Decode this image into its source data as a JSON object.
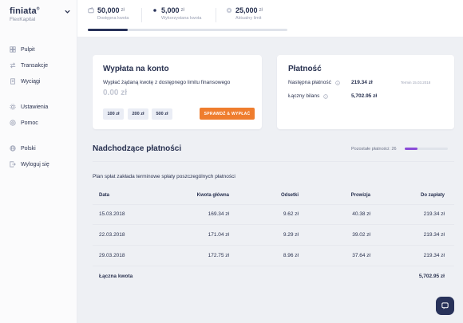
{
  "brand": {
    "name": "finiata",
    "trademark": "®",
    "product": "FlexKapital"
  },
  "sidebar": {
    "items": [
      {
        "label": "Pulpit",
        "icon": "dashboard-icon"
      },
      {
        "label": "Transakcje",
        "icon": "transactions-icon"
      },
      {
        "label": "Wyciągi",
        "icon": "statements-icon"
      },
      {
        "label": "Ustawienia",
        "icon": "gear-icon"
      },
      {
        "label": "Pomoc",
        "icon": "help-icon"
      },
      {
        "label": "Polski",
        "icon": "globe-icon"
      },
      {
        "label": "Wyloguj się",
        "icon": "logout-icon"
      }
    ]
  },
  "stats": [
    {
      "value": "50,000",
      "unit": "zł",
      "label": "Dostępna kwota",
      "icon": "wallet-icon"
    },
    {
      "value": "5,000",
      "unit": "zł",
      "label": "Wykorzystana kwota",
      "icon": "dot-icon"
    },
    {
      "value": "25,000",
      "unit": "zł",
      "label": "Aktualny limit",
      "icon": "limit-icon"
    }
  ],
  "usage_progress": 0.2,
  "withdraw": {
    "title": "Wypłata na konto",
    "description": "Wypłać żądaną kwotę z dostępnego limitu finansowego",
    "amount_placeholder": "0.00 zł",
    "chips": [
      "100 zł",
      "200 zł",
      "500 zł"
    ],
    "button": "SPRAWDŹ & WYPŁAĆ"
  },
  "payment": {
    "title": "Płatność",
    "next_label": "Następna płatność",
    "next_value": "219.34 zł",
    "due": "Termin 15.03.2018",
    "balance_label": "Łączny bilans",
    "balance_value": "5,702.95 zł"
  },
  "upcoming": {
    "title": "Nadchodzące płatności",
    "remaining": "Pozostałe płatności: 26",
    "remaining_progress": 0.3,
    "plan": "Plan spłat zakłada terminowe spłaty poszczególnych płatności",
    "headers": [
      "Data",
      "Kwota główna",
      "Odsetki",
      "Prowizja",
      "Do zapłaty"
    ],
    "rows": [
      [
        "15.03.2018",
        "169.34 zł",
        "9.62 zł",
        "40.38 zł",
        "219.34 zł"
      ],
      [
        "22.03.2018",
        "171.04 zł",
        "9.29 zł",
        "39.02 zł",
        "219.34 zł"
      ],
      [
        "29.03.2018",
        "172.75 zł",
        "8.96 zł",
        "37.64 zł",
        "219.34 zł"
      ]
    ],
    "total_label": "Łączna kwota",
    "total_value": "5,702.95 zł"
  },
  "colors": {
    "accent": "#ef7d2e",
    "navy": "#28325a",
    "purple": "#8a4bd8"
  }
}
